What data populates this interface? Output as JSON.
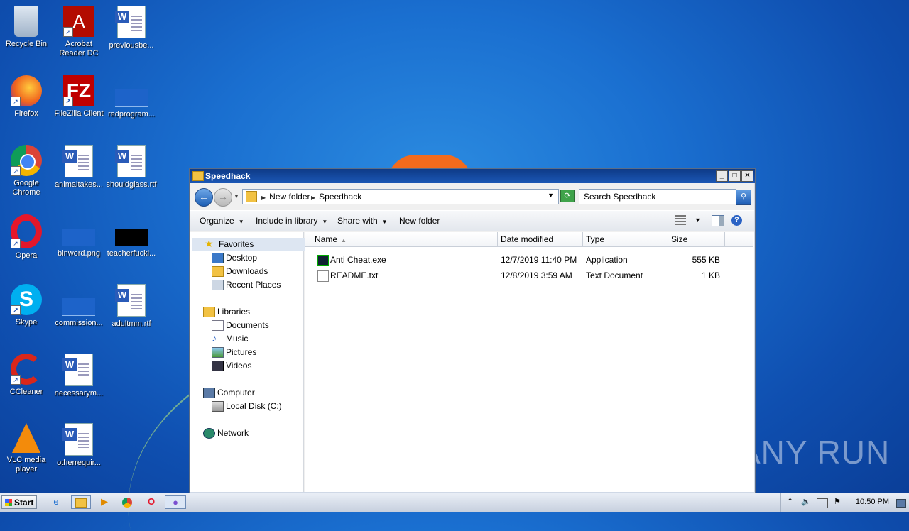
{
  "desktop": {
    "icons": [
      {
        "label": "Recycle Bin"
      },
      {
        "label": "Acrobat Reader DC"
      },
      {
        "label": "previousbe..."
      },
      {
        "label": "Firefox"
      },
      {
        "label": "FileZilla Client"
      },
      {
        "label": "redprogram..."
      },
      {
        "label": "Google Chrome"
      },
      {
        "label": "animaltakes..."
      },
      {
        "label": "shouldglass.rtf"
      },
      {
        "label": "Opera"
      },
      {
        "label": "binword.png"
      },
      {
        "label": "teacherfucki..."
      },
      {
        "label": "Skype"
      },
      {
        "label": "commission..."
      },
      {
        "label": "adultmm.rtf"
      },
      {
        "label": "CCleaner"
      },
      {
        "label": "necessarym..."
      },
      {
        "label": "VLC media player"
      },
      {
        "label": "otherrequir..."
      }
    ],
    "watermark": "ANY RUN"
  },
  "window": {
    "title": "Speedhack",
    "breadcrumb": [
      "New folder",
      "Speedhack"
    ],
    "search_placeholder": "Search Speedhack",
    "toolbar": {
      "organize": "Organize",
      "include_in_library": "Include in library",
      "share_with": "Share with",
      "new_folder": "New folder"
    },
    "nav": {
      "favorites": "Favorites",
      "desktop": "Desktop",
      "downloads": "Downloads",
      "recent": "Recent Places",
      "libraries": "Libraries",
      "documents": "Documents",
      "music": "Music",
      "pictures": "Pictures",
      "videos": "Videos",
      "computer": "Computer",
      "local_disk": "Local Disk (C:)",
      "network": "Network"
    },
    "columns": {
      "name": "Name",
      "date": "Date modified",
      "type": "Type",
      "size": "Size"
    },
    "files": [
      {
        "name": "Anti Cheat.exe",
        "date": "12/7/2019 11:40 PM",
        "type": "Application",
        "size": "555 KB"
      },
      {
        "name": "README.txt",
        "date": "12/8/2019 3:59 AM",
        "type": "Text Document",
        "size": "1 KB"
      }
    ]
  },
  "taskbar": {
    "start": "Start",
    "clock": "10:50 PM"
  }
}
